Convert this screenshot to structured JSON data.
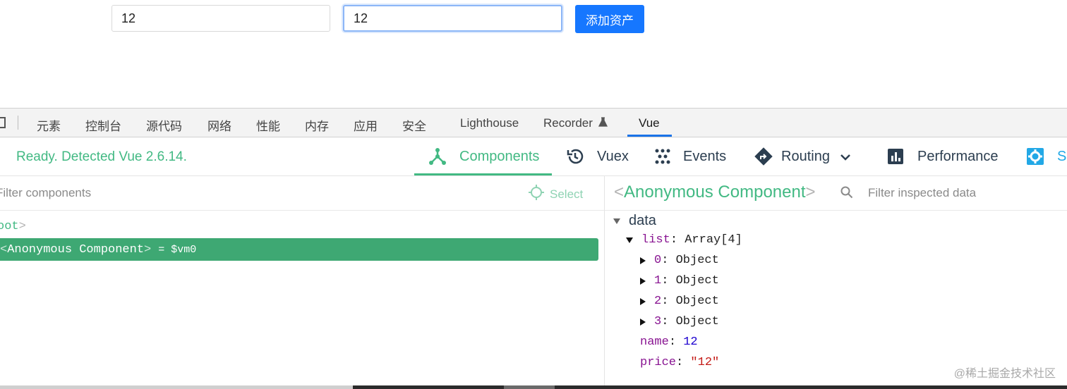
{
  "page": {
    "input1_value": "12",
    "input2_value": "12",
    "add_button_label": "添加资产"
  },
  "devtools": {
    "tabs": [
      "元素",
      "控制台",
      "源代码",
      "网络",
      "性能",
      "内存",
      "应用",
      "安全",
      "Lighthouse",
      "Recorder",
      "Vue"
    ],
    "active_tab": "Vue",
    "recorder_icon": "flask-icon"
  },
  "vue_panel": {
    "status": "Ready. Detected Vue 2.6.14.",
    "tabs": [
      {
        "label": "Components",
        "icon": "components-icon"
      },
      {
        "label": "Vuex",
        "icon": "history-icon"
      },
      {
        "label": "Events",
        "icon": "events-icon"
      },
      {
        "label": "Routing",
        "icon": "routing-icon"
      },
      {
        "label": "Performance",
        "icon": "performance-icon"
      },
      {
        "label": "Se",
        "icon": "settings-icon"
      }
    ],
    "active_tab": "Components",
    "colors": {
      "accent": "#42b983",
      "selected_row": "#3ea873",
      "key": "#881391",
      "number": "#1c00cf",
      "string": "#c41a16"
    }
  },
  "components_pane": {
    "filter_placeholder": "Filter components",
    "select_label": "Select",
    "tree": {
      "root_label": "Root",
      "root_visible": "oot",
      "selected_name": "Anonymous Component",
      "selected_suffix": "= $vm0"
    }
  },
  "inspector": {
    "component_title": "Anonymous Component",
    "filter_placeholder": "Filter inspected data",
    "section": "data",
    "list_key": "list",
    "list_type": "Array[4]",
    "items": [
      {
        "index": "0",
        "type": "Object"
      },
      {
        "index": "1",
        "type": "Object"
      },
      {
        "index": "2",
        "type": "Object"
      },
      {
        "index": "3",
        "type": "Object"
      }
    ],
    "name_key": "name",
    "name_value": "12",
    "price_key": "price",
    "price_value": "\"12\""
  },
  "watermark": "@稀土掘金技术社区"
}
